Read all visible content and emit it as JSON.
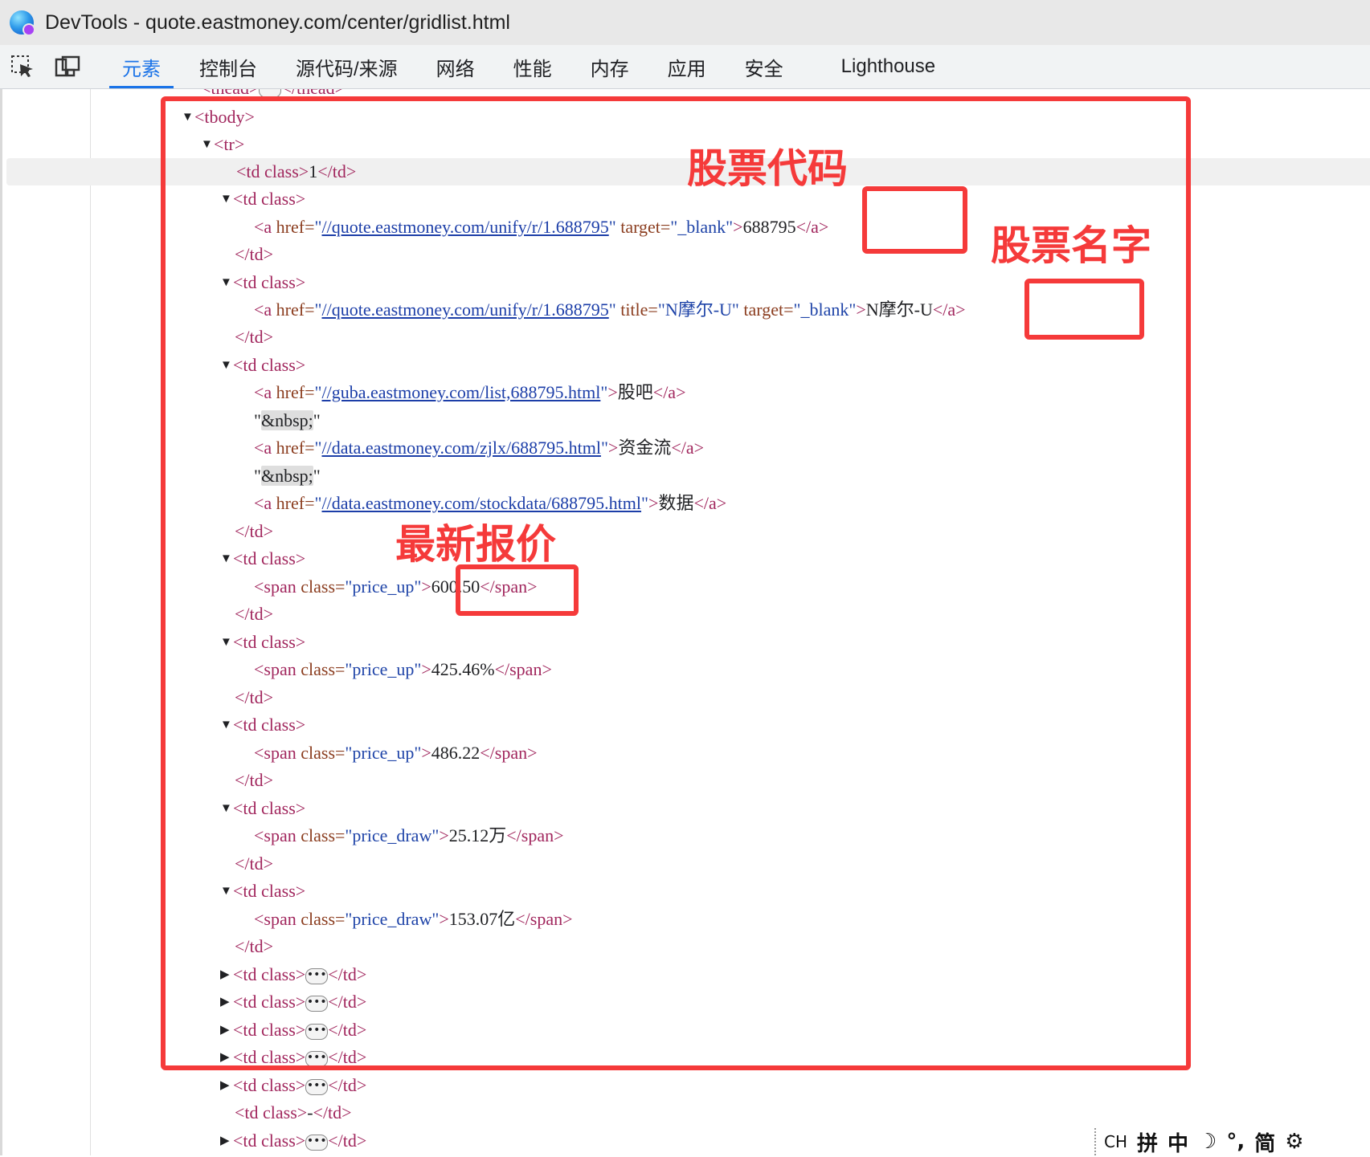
{
  "window": {
    "title": "DevTools - quote.eastmoney.com/center/gridlist.html"
  },
  "toolbar": {
    "tabs": [
      {
        "label": "元素",
        "active": true
      },
      {
        "label": "控制台",
        "active": false
      },
      {
        "label": "源代码/来源",
        "active": false
      },
      {
        "label": "网络",
        "active": false
      },
      {
        "label": "性能",
        "active": false
      },
      {
        "label": "内存",
        "active": false
      },
      {
        "label": "应用",
        "active": false
      },
      {
        "label": "安全",
        "active": false
      },
      {
        "label": "Lighthouse",
        "active": false
      }
    ],
    "accent_color": "#1a73e8"
  },
  "code": {
    "thead_open": "<thead>",
    "thead_close": "</thead>",
    "tbody_open": "<tbody>",
    "tr_open": "<tr>",
    "td_class_open": "<td class>",
    "td_close": "</td>",
    "a_open": "<a",
    "a_close": "</a>",
    "span_open": "<span",
    "span_close": "</span>",
    "href_attr": " href=",
    "title_attr": " title=",
    "target_attr": " target=",
    "class_attr": " class=",
    "quote": "\"",
    "gt": ">",
    "td1_text": "1",
    "code_link": "//quote.eastmoney.com/unify/r/1.688795",
    "target_value": "_blank",
    "code_text": "688795",
    "name_title": "N摩尔-U",
    "name_text": "N摩尔-U",
    "guba_link": "//guba.eastmoney.com/list,688795.html",
    "guba_text": "股吧",
    "nbsp": "&nbsp;",
    "zjlx_link": "//data.eastmoney.com/zjlx/688795.html",
    "zjlx_text": "资金流",
    "stockdata_link": "//data.eastmoney.com/stockdata/688795.html",
    "stockdata_text": "数据",
    "class_price_up": "price_up",
    "class_price_draw": "price_draw",
    "price": "600.50",
    "change_pct": "425.46%",
    "change_amt": "486.22",
    "volume": "25.12万",
    "turnover": "153.07亿",
    "dash": "-",
    "ellipsis": "•••"
  },
  "annotations": {
    "code_label": "股票代码",
    "name_label": "股票名字",
    "price_label": "最新报价",
    "color": "#f53a3a"
  },
  "ime": {
    "ch": "CH",
    "pin": "拼",
    "zhong": "中",
    "moon": "☽",
    "punct": "°,",
    "jian": "简",
    "gear": "⚙"
  },
  "icons": [
    "inspect-element-icon",
    "device-toolbar-icon",
    "expand-triangle-icon",
    "collapse-triangle-icon"
  ]
}
